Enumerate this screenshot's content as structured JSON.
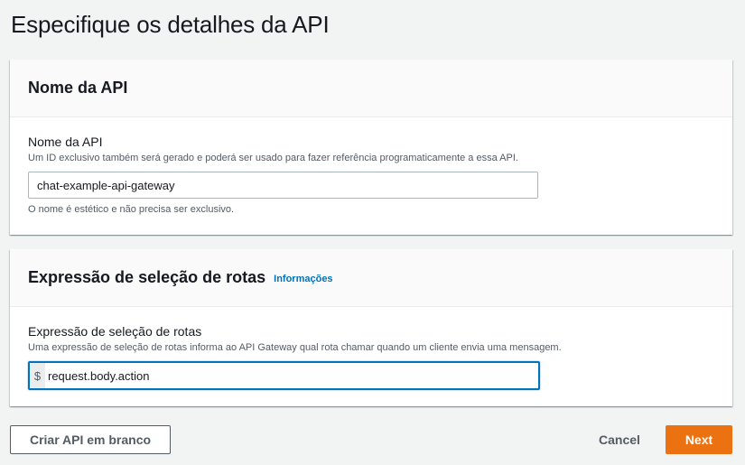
{
  "page": {
    "title": "Especifique os detalhes da API"
  },
  "api_name_panel": {
    "header": "Nome da API",
    "field_label": "Nome da API",
    "field_description": "Um ID exclusivo também será gerado e poderá ser usado para fazer referência programaticamente a essa API.",
    "value": "chat-example-api-gateway",
    "hint": "O nome é estético e não precisa ser exclusivo."
  },
  "route_panel": {
    "header": "Expressão de seleção de rotas",
    "info_link": "Informações",
    "field_label": "Expressão de seleção de rotas",
    "field_description": "Uma expressão de seleção de rotas informa ao API Gateway qual rota chamar quando um cliente envia uma mensagem.",
    "prefix": "$",
    "value": "request.body.action"
  },
  "footer": {
    "blank_api_label": "Criar API em branco",
    "cancel_label": "Cancel",
    "next_label": "Next"
  },
  "colors": {
    "primary": "#ec7211",
    "link": "#0073bb",
    "focus_border": "#0073bb"
  }
}
